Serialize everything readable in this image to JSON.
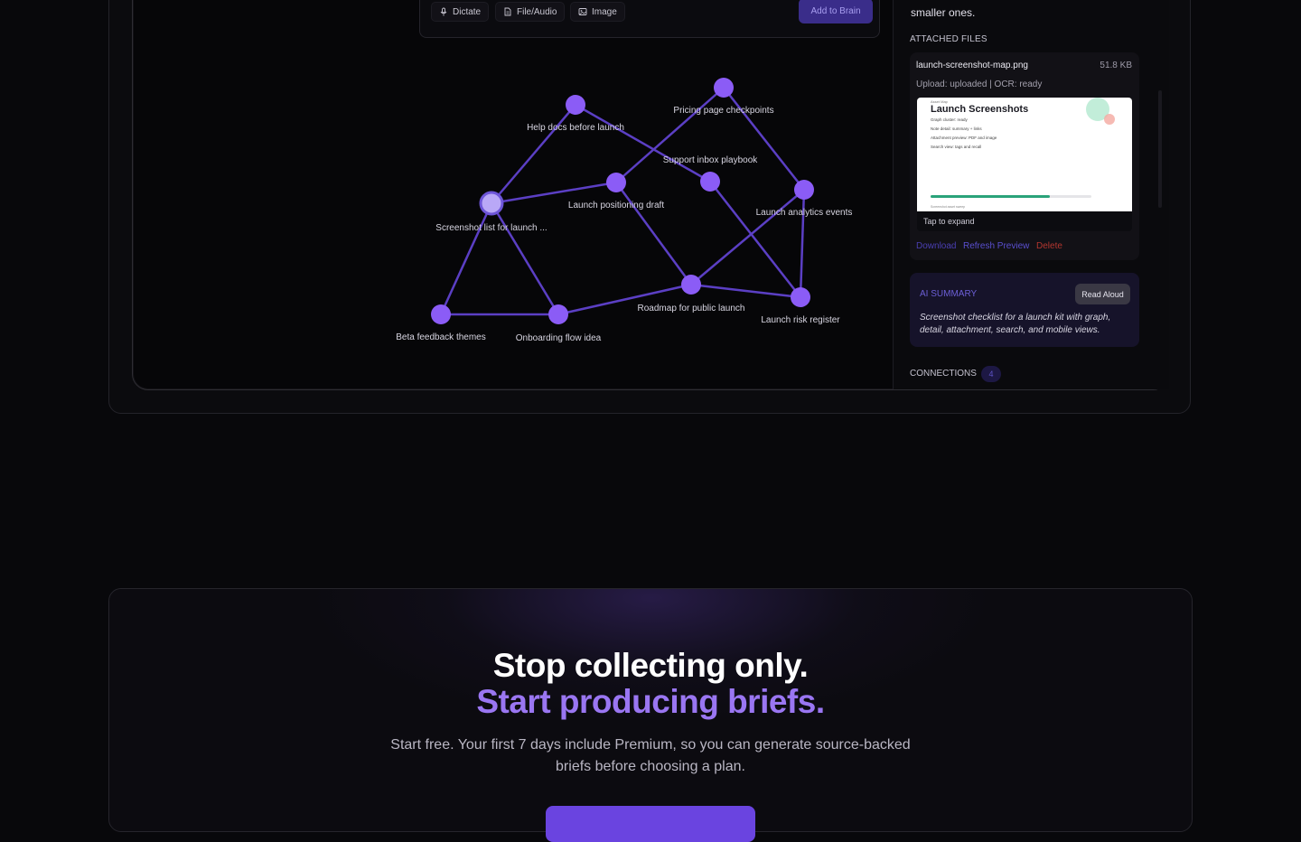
{
  "composer": {
    "dictate_label": "Dictate",
    "file_audio_label": "File/Audio",
    "image_label": "Image",
    "add_to_brain_label": "Add to Brain"
  },
  "graph": {
    "nodes": [
      {
        "label": "Help docs before launch"
      },
      {
        "label": "Pricing page checkpoints"
      },
      {
        "label": "Support inbox playbook"
      },
      {
        "label": "Launch positioning draft"
      },
      {
        "label": "Launch analytics events"
      },
      {
        "label": "Screenshot list for launch ..."
      },
      {
        "label": "Roadmap for public launch"
      },
      {
        "label": "Launch risk register"
      },
      {
        "label": "Beta feedback themes"
      },
      {
        "label": "Onboarding flow idea"
      }
    ]
  },
  "side_panel": {
    "intro_text": "smaller ones.",
    "attached_files_label": "ATTACHED FILES",
    "file": {
      "name": "launch-screenshot-map.png",
      "size": "51.8 KB",
      "status": "Upload: uploaded | OCR: ready",
      "preview_kicker": "Asset Map",
      "preview_title": "Launch Screenshots",
      "preview_lines": [
        "Graph cluster: ready",
        "Note detail: summary + links",
        "Attachment preview: PDF and image",
        "Search view: tags and recall"
      ],
      "preview_progress": 0.74,
      "preview_caption": "Screenshot asset sweep",
      "tap_to_expand": "Tap to expand",
      "actions": {
        "download": "Download",
        "refresh": "Refresh Preview",
        "delete": "Delete"
      }
    },
    "summary": {
      "label": "AI SUMMARY",
      "read_aloud_label": "Read Aloud",
      "text": "Screenshot checklist for a launch kit with graph, detail, attachment, search, and mobile views."
    },
    "connections": {
      "label": "CONNECTIONS",
      "count": "4"
    }
  },
  "cta": {
    "headline_line1": "Stop collecting only.",
    "headline_line2": "Start producing briefs.",
    "body": "Start free. Your first 7 days include Premium, so you can generate source-backed briefs before choosing a plan."
  },
  "colors": {
    "accent": "#7c5cf0",
    "node": "#8b5cf6",
    "edge": "#5b3fc4",
    "delete": "#b3362f",
    "link": "#4a3fb3"
  }
}
